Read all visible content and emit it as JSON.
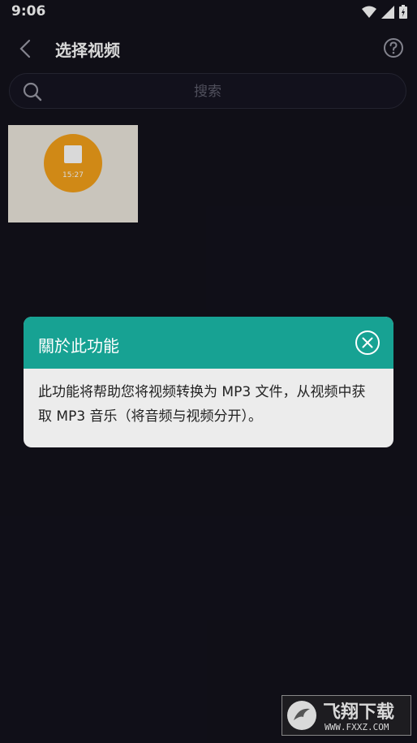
{
  "status_bar": {
    "time": "9:06",
    "icons": [
      "wifi-icon",
      "signal-icon",
      "battery-icon"
    ]
  },
  "app_bar": {
    "title": "选择视频",
    "back_icon": "back-chevron-icon",
    "help_icon": "help-icon"
  },
  "search": {
    "placeholder": "搜索",
    "icon": "search-icon"
  },
  "videos": [
    {
      "duration": "15:27"
    }
  ],
  "dialog": {
    "title": "關於此功能",
    "body": "此功能将帮助您将视频转换为 MP3 文件，从视频中获取 MP3 音乐（将音频与视频分开）。",
    "close_icon": "close-circle-icon"
  },
  "watermark": {
    "text": "飞翔下载",
    "url": "WWW.FXXZ.COM"
  },
  "colors": {
    "background": "#13121c",
    "dialog_header": "#17a293",
    "dialog_body": "#ececec",
    "thumb_accent": "#f5a11b"
  }
}
